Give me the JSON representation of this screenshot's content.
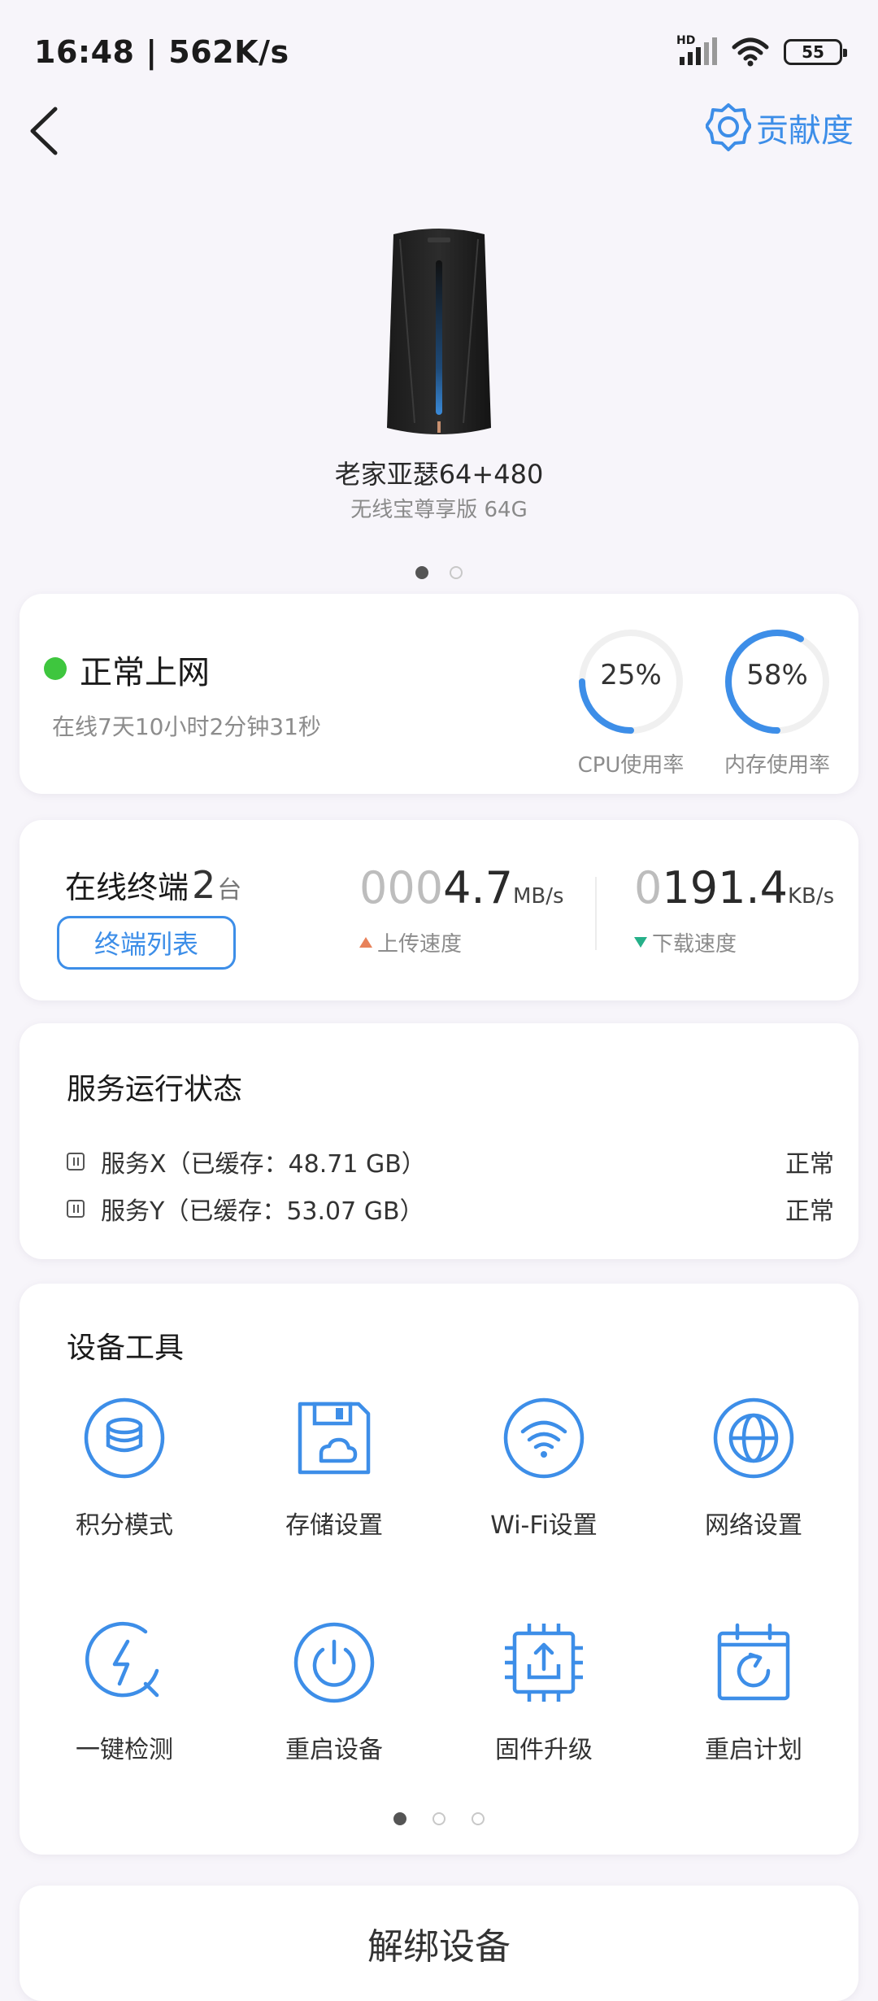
{
  "status_bar": {
    "time_speed": "16:48 | 562K/s",
    "signal_badge": "HD",
    "battery": "55"
  },
  "header": {
    "contribution_label": "贡献度"
  },
  "device": {
    "name": "老家亚瑟64+480",
    "model": "无线宝尊享版 64G",
    "pager": {
      "count": 2,
      "active": 0
    }
  },
  "status_card": {
    "title": "正常上网",
    "uptime": "在线7天10小时2分钟31秒",
    "cpu": {
      "value": "25%",
      "percent": 25,
      "label": "CPU使用率"
    },
    "memory": {
      "value": "58%",
      "percent": 58,
      "label": "内存使用率"
    }
  },
  "terminal_card": {
    "title": "在线终端",
    "count": "2",
    "unit": "台",
    "list_button": "终端列表",
    "upload": {
      "leading": "000",
      "value": "4.7",
      "unit": "MB/s",
      "label": "上传速度"
    },
    "download": {
      "leading": "0",
      "value": "191.4",
      "unit": "KB/s",
      "label": "下载速度"
    }
  },
  "services": {
    "title": "服务运行状态",
    "items": [
      {
        "name": "服务X（已缓存：48.71 GB）",
        "status": "正常"
      },
      {
        "name": "服务Y（已缓存：53.07 GB）",
        "status": "正常"
      }
    ]
  },
  "tools": {
    "title": "设备工具",
    "items": [
      {
        "label": "积分模式",
        "icon": "coins-icon"
      },
      {
        "label": "存储设置",
        "icon": "storage-icon"
      },
      {
        "label": "Wi-Fi设置",
        "icon": "wifi-icon"
      },
      {
        "label": "网络设置",
        "icon": "globe-icon"
      },
      {
        "label": "一键检测",
        "icon": "diagnose-icon"
      },
      {
        "label": "重启设备",
        "icon": "power-icon"
      },
      {
        "label": "固件升级",
        "icon": "firmware-icon"
      },
      {
        "label": "重启计划",
        "icon": "schedule-icon"
      }
    ],
    "pager": {
      "count": 3,
      "active": 0
    }
  },
  "unbind_button": "解绑设备",
  "colors": {
    "accent": "#3d8ee8",
    "online": "#3ec63e",
    "upload_arrow": "#e8825a",
    "download_arrow": "#26b089",
    "background": "#f7f5fa"
  }
}
